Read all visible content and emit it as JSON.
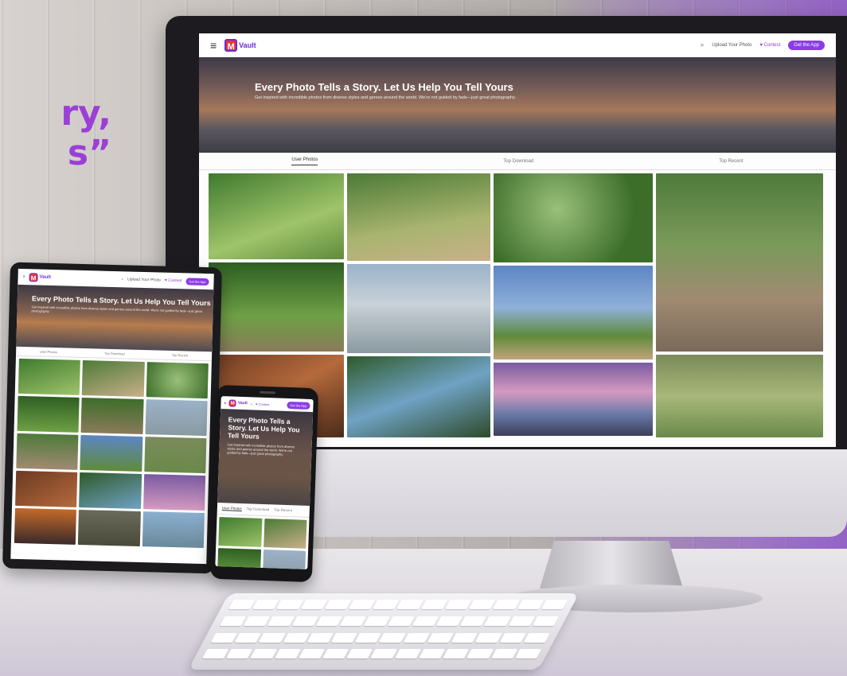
{
  "headline": {
    "line1": "ry,",
    "line2": "s”"
  },
  "site": {
    "logo_letter": "M",
    "logo_text": "Vault",
    "search_icon": "search-icon",
    "upload_label": "Upload Your Photo",
    "contest_label": "♥ Contest",
    "get_app_label": "Get the App"
  },
  "desktop": {
    "hero_title": "Every Photo Tells a Story. Let Us Help You Tell Yours",
    "hero_subtitle": "Get inspired with incredible photos from diverse styles and genres around the world. We're not guided by fads—just great photography.",
    "tabs": [
      "User Photos",
      "Top Download",
      "Top Recent"
    ]
  },
  "tablet": {
    "hero_title": "Every Photo Tells a Story. Let Us Help You Tell Yours",
    "hero_subtitle": "Get inspired with incredible photos from diverse styles and genres around the world. We're not guided by fads—just great photography.",
    "tabs": [
      "User Photos",
      "Top Download",
      "Top Recent"
    ]
  },
  "phone": {
    "hero_title": "Every Photo Tells a Story. Let Us Help You Tell Yours",
    "hero_subtitle": "Get inspired with incredible photos from diverse styles and genres around the world. We're not guided by fads—just great photography.",
    "tabs": [
      "User Photos",
      "Top Download",
      "Top Recent"
    ]
  },
  "colors": {
    "accent": "#8b3ce6",
    "headline": "#9b3fd6",
    "logo_red": "#e33333"
  }
}
